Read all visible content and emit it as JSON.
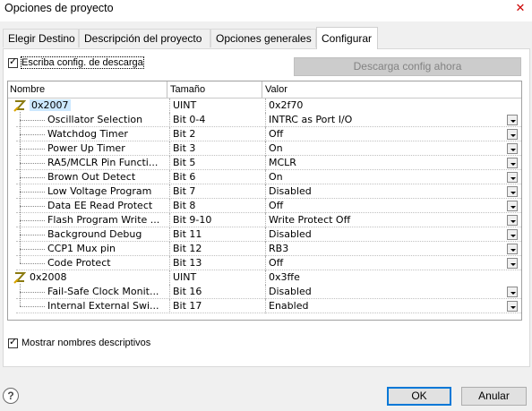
{
  "window": {
    "title": "Opciones de proyecto",
    "close_glyph": "✕"
  },
  "tabs": [
    {
      "label": "Elegir Destino"
    },
    {
      "label": "Descripción del proyecto"
    },
    {
      "label": "Opciones generales"
    },
    {
      "label": "Configurar"
    }
  ],
  "write_config": {
    "label": "Escriba config. de descarga",
    "checked": true
  },
  "download_button": {
    "label": "Descarga config ahora",
    "enabled": false
  },
  "grid": {
    "columns": [
      "Nombre",
      "Tamaño",
      "Valor"
    ],
    "rows": [
      {
        "type": "group",
        "name": "0x2007",
        "size": "UINT",
        "value": "0x2f70",
        "selected": true
      },
      {
        "type": "item",
        "name": "Oscillator Selection",
        "size": "Bit 0-4",
        "value": "INTRC as Port I/O"
      },
      {
        "type": "item",
        "name": "Watchdog Timer",
        "size": "Bit 2",
        "value": "Off"
      },
      {
        "type": "item",
        "name": "Power Up Timer",
        "size": "Bit 3",
        "value": "On"
      },
      {
        "type": "item",
        "name": "RA5/MCLR Pin Functi...",
        "size": "Bit 5",
        "value": "MCLR"
      },
      {
        "type": "item",
        "name": "Brown Out Detect",
        "size": "Bit 6",
        "value": "On"
      },
      {
        "type": "item",
        "name": "Low Voltage Program",
        "size": "Bit 7",
        "value": "Disabled"
      },
      {
        "type": "item",
        "name": "Data EE Read Protect",
        "size": "Bit 8",
        "value": "Off"
      },
      {
        "type": "item",
        "name": "Flash Program Write ...",
        "size": "Bit 9-10",
        "value": "Write Protect Off"
      },
      {
        "type": "item",
        "name": "Background Debug",
        "size": "Bit 11",
        "value": "Disabled"
      },
      {
        "type": "item",
        "name": "CCP1 Mux pin",
        "size": "Bit 12",
        "value": "RB3"
      },
      {
        "type": "item",
        "name": "Code Protect",
        "size": "Bit 13",
        "value": "Off"
      },
      {
        "type": "group",
        "name": "0x2008",
        "size": "UINT",
        "value": "0x3ffe",
        "selected": false
      },
      {
        "type": "item",
        "name": "Fail-Safe Clock Monit...",
        "size": "Bit 16",
        "value": "Disabled"
      },
      {
        "type": "item",
        "name": "Internal External Swi...",
        "size": "Bit 17",
        "value": "Enabled"
      }
    ]
  },
  "show_names": {
    "label": "Mostrar nombres descriptivos",
    "checked": true
  },
  "footer": {
    "help_glyph": "?",
    "ok_label": "OK",
    "cancel_label": "Anular"
  },
  "colors": {
    "selection": "#cce8ff",
    "primary_border": "#0078d7",
    "close_red": "#cc0000"
  }
}
